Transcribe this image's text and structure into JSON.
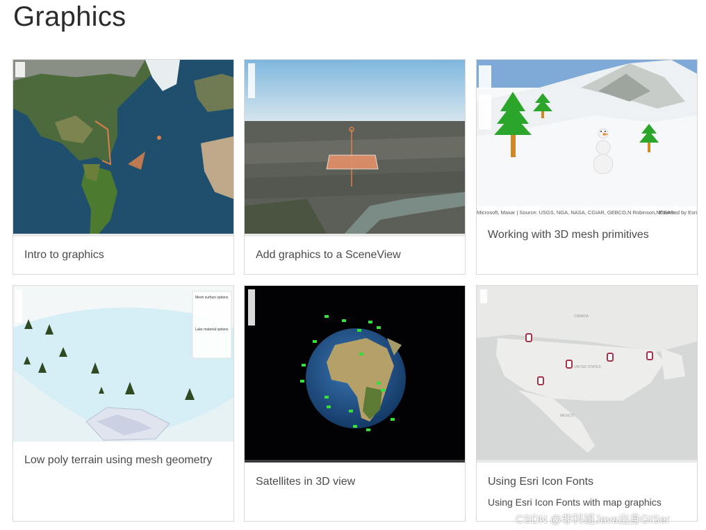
{
  "page": {
    "title": "Graphics"
  },
  "cards": [
    {
      "title": "Intro to graphics",
      "description": ""
    },
    {
      "title": "Add graphics to a SceneView",
      "description": ""
    },
    {
      "title": "Working with 3D mesh primitives",
      "description": ""
    },
    {
      "title": "Low poly terrain using mesh geometry",
      "description": ""
    },
    {
      "title": "Satellites in 3D view",
      "description": ""
    },
    {
      "title": "Using Esri Icon Fonts",
      "description": "Using Esri Icon Fonts with map graphics"
    }
  ],
  "mesh_panel": {
    "heading1": "Mesh surface options",
    "heading2": "Lake material options"
  },
  "attribution": {
    "mesh": "Microsoft, Maxar | Source: USGS, NGA, NASA, CGIAR, GEBCO,N Robinson,NCEAS...",
    "powered": "Powered by Esri"
  },
  "map_labels": {
    "canada": "CANADA",
    "united_states": "UNITED STATES",
    "mexico": "MÉXICO"
  },
  "watermark": "CSDN @非科班Java出身GISer",
  "colors": {
    "accent_orange": "#d9804a",
    "pin_red": "#a3324a",
    "tree_green": "#2ca62a",
    "satellite_green": "#35e03a"
  }
}
